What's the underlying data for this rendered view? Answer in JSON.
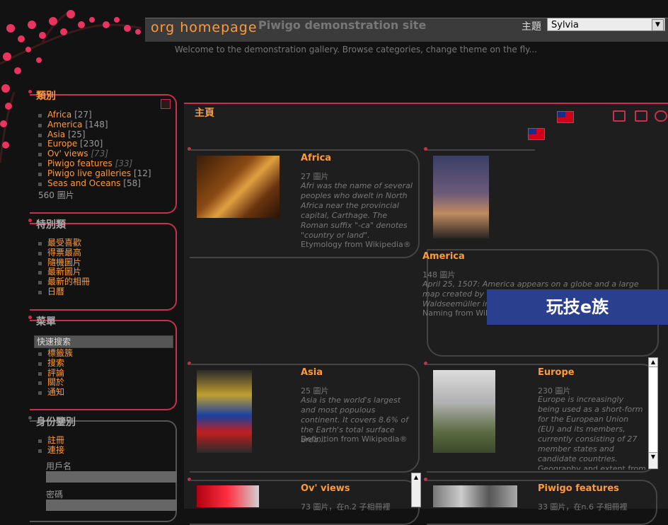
{
  "header": {
    "title": "org homepage",
    "subtitle": "Piwigo demonstration site",
    "theme_label": "主題",
    "theme_value": "Sylvia",
    "welcome": "Welcome to the demonstration gallery. Browse categories, change theme on the fly..."
  },
  "categories": {
    "title": "類別",
    "items": [
      {
        "label": "Africa",
        "count": "[27]"
      },
      {
        "label": "America",
        "count": "[148]"
      },
      {
        "label": "Asia",
        "count": "[25]"
      },
      {
        "label": "Europe",
        "count": "[230]"
      },
      {
        "label": "Ov' views",
        "count": "[73]"
      },
      {
        "label": "Piwigo features",
        "count": "[33]"
      },
      {
        "label": "Piwigo live galleries",
        "count": "[12]"
      },
      {
        "label": "Seas and Oceans",
        "count": "[58]"
      }
    ],
    "total": "560 圖片"
  },
  "specials": {
    "title": "特別類",
    "items": [
      "最受喜歡",
      "得票最高",
      "隨機圖片",
      "最新圖片",
      "最新的相冊",
      "日曆"
    ]
  },
  "menu": {
    "title": "菜單",
    "quick_search": "快速搜索",
    "items": [
      "標籤簇",
      "搜索",
      "評論",
      "關於",
      "通知"
    ]
  },
  "identification": {
    "title": "身份鑒別",
    "items": [
      "註冊",
      "連接"
    ],
    "username_label": "用戶名",
    "password_label": "密碼"
  },
  "main": {
    "title": "主頁",
    "banner": "玩技e族",
    "cards": {
      "africa": {
        "title": "Africa",
        "meta": "27 圖片",
        "desc": "Afri was the name of several peoples who dwelt in North Africa near the provincial capital, Carthage. The Roman suffix \"-ca\" denotes \"country or land\".",
        "source": "Etymology from Wikipedia®"
      },
      "america": {
        "title": "America",
        "meta": "148 圖片",
        "desc": "April 25, 1507: America appears on a globe and a large map created by the German cartographer Martin Waldseemüller in Saint-Dié-des-Vosges.",
        "source": "Naming from Wikipedia®"
      },
      "asia": {
        "title": "Asia",
        "meta": "25 圖片",
        "desc": "Asia is the world's largest and most populous continent. It covers 8.6% of the Earth's total surface area...",
        "source": "Definition from Wikipedia®"
      },
      "europe": {
        "title": "Europe",
        "meta": "230 圖片",
        "desc": "Europe is increasingly being used as a short-form for the European Union (EU) and its members, currently consisting of 27 member states and candidate countries.",
        "source": "Geography and extent from Wikipedia®"
      },
      "ovviews": {
        "title": "Ov' views",
        "meta": "73 圖片，在n.2 子相冊裡"
      },
      "features": {
        "title": "Piwigo features",
        "meta": "33 圖片，在n.6 子相冊裡"
      }
    }
  }
}
